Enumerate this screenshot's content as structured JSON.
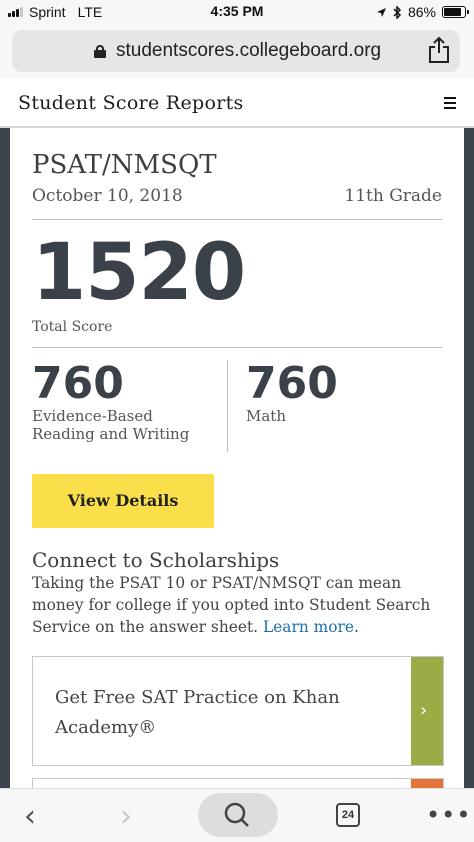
{
  "status_bar": {
    "carrier": "Sprint",
    "network": "LTE",
    "time": "4:35 PM",
    "battery": "86%"
  },
  "browser": {
    "url": "studentscores.collegeboard.org",
    "tab_count": "24"
  },
  "site_header": {
    "title": "Student Score Reports"
  },
  "score_card": {
    "exam": "PSAT/NMSQT",
    "date": "October 10, 2018",
    "grade": "11th Grade",
    "total_score": "1520",
    "total_label": "Total Score",
    "sections": [
      {
        "score": "760",
        "label_line1": "Evidence-Based",
        "label_line2": "Reading and Writing"
      },
      {
        "score": "760",
        "label_line1": "Math",
        "label_line2": ""
      }
    ],
    "details_button": "View Details"
  },
  "scholarships": {
    "title": "Connect to Scholarships",
    "text": "Taking the PSAT 10 or PSAT/NMSQT can mean money for college if you opted into Student Search Service on the answer sheet.",
    "link": "Learn more",
    "link_suffix": "."
  },
  "promo": {
    "text": "Get Free SAT Practice on Khan Academy®"
  },
  "colors": {
    "button": "#fbdf4a",
    "promo_arrow": "#9aac45",
    "next_arrow": "#e5743b",
    "link": "#1f6fa8",
    "frame": "#3d444d"
  }
}
